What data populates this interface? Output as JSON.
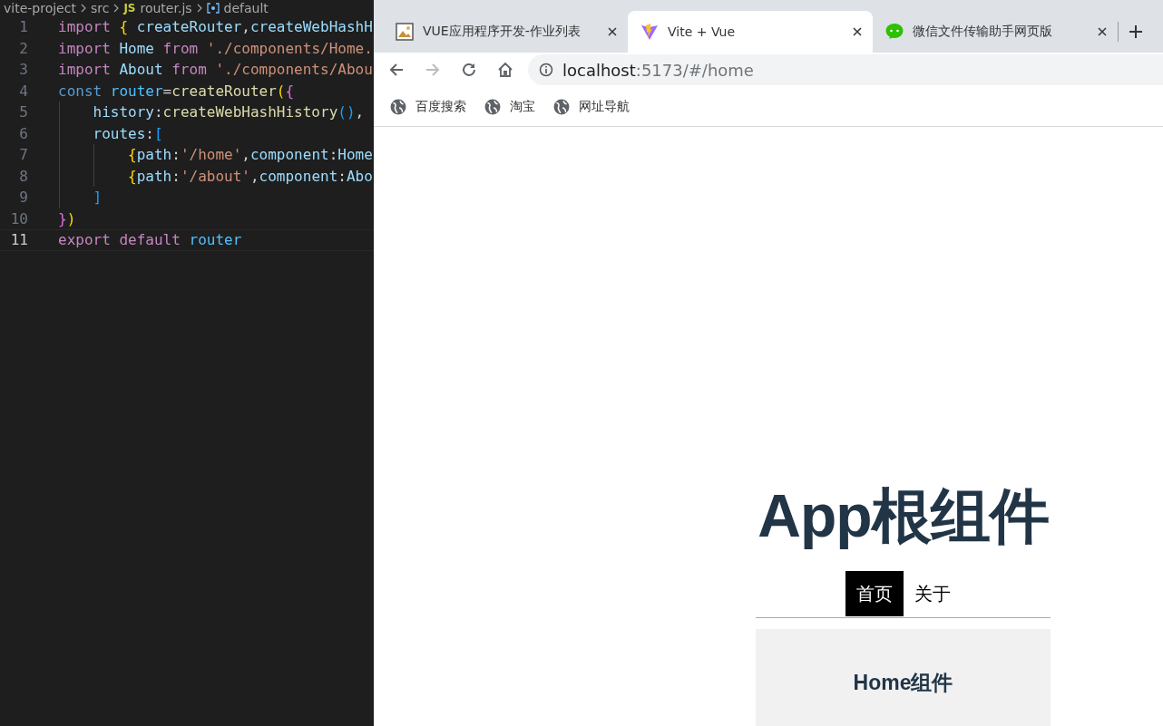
{
  "editor": {
    "breadcrumb": [
      {
        "kind": "folder",
        "label": "vite-project"
      },
      {
        "kind": "folder",
        "label": "src"
      },
      {
        "kind": "js-file",
        "badge": "JS",
        "label": "router.js"
      },
      {
        "kind": "symbol",
        "label": "default"
      }
    ],
    "lines": [
      {
        "number": "1",
        "current": false,
        "tokens": [
          {
            "kind": "kw",
            "text": "import "
          },
          {
            "kind": "b1",
            "text": "{ "
          },
          {
            "kind": "var",
            "text": "createRouter"
          },
          {
            "kind": "plain",
            "text": ","
          },
          {
            "kind": "var",
            "text": "createWebHashH"
          }
        ]
      },
      {
        "number": "2",
        "current": false,
        "tokens": [
          {
            "kind": "kw",
            "text": "import "
          },
          {
            "kind": "var",
            "text": "Home "
          },
          {
            "kind": "kw",
            "text": "from "
          },
          {
            "kind": "str",
            "text": "'./components/Home."
          }
        ]
      },
      {
        "number": "3",
        "current": false,
        "tokens": [
          {
            "kind": "kw",
            "text": "import "
          },
          {
            "kind": "var",
            "text": "About "
          },
          {
            "kind": "kw",
            "text": "from "
          },
          {
            "kind": "str",
            "text": "'./components/Abou"
          }
        ]
      },
      {
        "number": "4",
        "current": false,
        "tokens": [
          {
            "kind": "decl",
            "text": "const "
          },
          {
            "kind": "const",
            "text": "router"
          },
          {
            "kind": "plain",
            "text": "="
          },
          {
            "kind": "fn",
            "text": "createRouter"
          },
          {
            "kind": "b1",
            "text": "("
          },
          {
            "kind": "b2",
            "text": "{"
          }
        ]
      },
      {
        "number": "5",
        "current": false,
        "tokens": [
          {
            "kind": "var",
            "text": "    history"
          },
          {
            "kind": "plain",
            "text": ":"
          },
          {
            "kind": "fn",
            "text": "createWebHashHistory"
          },
          {
            "kind": "b3",
            "text": "()"
          },
          {
            "kind": "plain",
            "text": ","
          }
        ]
      },
      {
        "number": "6",
        "current": false,
        "tokens": [
          {
            "kind": "var",
            "text": "    routes"
          },
          {
            "kind": "plain",
            "text": ":"
          },
          {
            "kind": "b3",
            "text": "["
          }
        ]
      },
      {
        "number": "7",
        "current": false,
        "tokens": [
          {
            "kind": "b1",
            "text": "        {"
          },
          {
            "kind": "var",
            "text": "path"
          },
          {
            "kind": "plain",
            "text": ":"
          },
          {
            "kind": "str",
            "text": "'/home'"
          },
          {
            "kind": "plain",
            "text": ","
          },
          {
            "kind": "var",
            "text": "component"
          },
          {
            "kind": "plain",
            "text": ":"
          },
          {
            "kind": "var",
            "text": "Home"
          }
        ]
      },
      {
        "number": "8",
        "current": false,
        "tokens": [
          {
            "kind": "b1",
            "text": "        {"
          },
          {
            "kind": "var",
            "text": "path"
          },
          {
            "kind": "plain",
            "text": ":"
          },
          {
            "kind": "str",
            "text": "'/about'"
          },
          {
            "kind": "plain",
            "text": ","
          },
          {
            "kind": "var",
            "text": "component"
          },
          {
            "kind": "plain",
            "text": ":"
          },
          {
            "kind": "var",
            "text": "Abo"
          }
        ]
      },
      {
        "number": "9",
        "current": false,
        "tokens": [
          {
            "kind": "b3",
            "text": "    ]"
          }
        ]
      },
      {
        "number": "10",
        "current": false,
        "tokens": [
          {
            "kind": "b2",
            "text": "}"
          },
          {
            "kind": "b1",
            "text": ")"
          }
        ]
      },
      {
        "number": "11",
        "current": true,
        "tokens": [
          {
            "kind": "kw",
            "text": "export default "
          },
          {
            "kind": "const",
            "text": "router"
          }
        ]
      }
    ]
  },
  "browser": {
    "tabs": [
      {
        "title": "VUE应用程序开发-作业列表",
        "kind": "image",
        "selected": false
      },
      {
        "title": "Vite + Vue",
        "kind": "vite",
        "selected": true
      },
      {
        "title": "微信文件传输助手网页版",
        "kind": "chat",
        "selected": false
      }
    ],
    "toolbar": {
      "back_disabled": false,
      "forward_disabled": true,
      "url_host": "localhost",
      "url_rest": ":5173/#/home"
    },
    "bookmarks": [
      {
        "label": "百度搜索"
      },
      {
        "label": "淘宝"
      },
      {
        "label": "网址导航"
      }
    ],
    "page": {
      "heading": "App根组件",
      "nav": [
        {
          "label": "首页",
          "selected": true
        },
        {
          "label": "关于",
          "selected": false
        }
      ],
      "view_heading": "Home组件"
    }
  }
}
